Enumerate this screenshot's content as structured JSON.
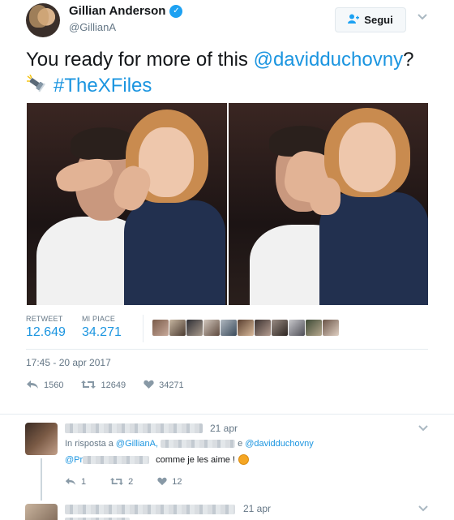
{
  "author": {
    "name": "Gillian Anderson",
    "handle": "@GillianA",
    "verified_mark": "✓",
    "avatar_icon": "avatar"
  },
  "follow_button": {
    "label": "Segui",
    "icon": "add-user-icon"
  },
  "menu_icon": "chevron-down-icon",
  "tweet": {
    "text_prefix": "You ready for more of this ",
    "mention": "@davidduchovny",
    "text_suffix": "?",
    "hashtag": "#TheXFiles"
  },
  "stats": {
    "retweet_label": "RETWEET",
    "retweet_value": "12.649",
    "likes_label": "MI PIACE",
    "likes_value": "34.271"
  },
  "timestamp": "17:45 - 20 apr 2017",
  "actions": {
    "reply_count": "1560",
    "retweet_count": "12649",
    "like_count": "34271"
  },
  "replies": [
    {
      "date": "21 apr",
      "reply_to_prefix": "In risposta a",
      "reply_to_first": "@GillianA,",
      "reply_to_conj": "e",
      "reply_to_last": "@davidduchovny",
      "body_mention": "@Pr",
      "body_text": "comme je les aime !",
      "reply_count": "1",
      "retweet_count": "2",
      "like_count": "12"
    },
    {
      "date": "21 apr"
    }
  ],
  "colors": {
    "accent": "#1b95e0",
    "verified": "#1da1f2",
    "muted": "#657786"
  }
}
